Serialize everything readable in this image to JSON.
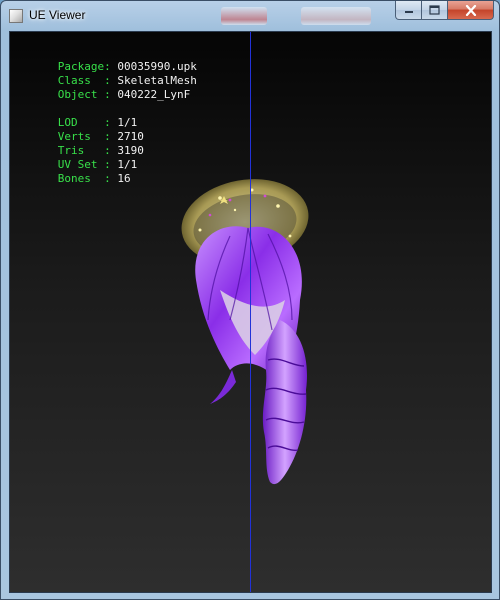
{
  "window": {
    "title": "UE Viewer",
    "controls": {
      "minimize": "—",
      "maximize": "☐",
      "close": "✕"
    }
  },
  "info": {
    "package": {
      "key": "Package:",
      "value": "00035990.upk"
    },
    "class": {
      "key": "Class  :",
      "value": "SkeletalMesh"
    },
    "object": {
      "key": "Object :",
      "value": "040222_LynF"
    },
    "lod": {
      "key": "LOD    :",
      "value": "1/1"
    },
    "verts": {
      "key": "Verts  :",
      "value": "2710"
    },
    "tris": {
      "key": "Tris   :",
      "value": "3190"
    },
    "uvset": {
      "key": "UV Set :",
      "value": "1/1"
    },
    "bones": {
      "key": "Bones  :",
      "value": "16"
    }
  },
  "colors": {
    "info_key": "#38e04a",
    "info_value": "#f2f2f2",
    "axis_line": "#2232d8",
    "hair": "#9a3cf0"
  },
  "icons": {
    "app": "app-window-icon",
    "minimize": "minimize-icon",
    "maximize": "maximize-icon",
    "close": "close-icon"
  }
}
